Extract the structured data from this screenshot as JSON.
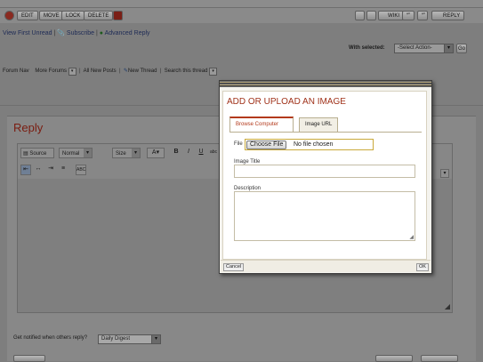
{
  "actionbar": {
    "edit_label": "EDIT",
    "move_label": "MOVE",
    "lock_label": "LOCK",
    "delete_label": "DELETE",
    "wiki_label": "WIKI",
    "quote_label": "“”",
    "reply_label": "REPLY"
  },
  "links": {
    "view_first_unread": "View First Unread",
    "subscribe": "Subscribe",
    "advanced_reply": "Advanced Reply"
  },
  "moderation": {
    "with_selected_label": "With selected:",
    "select_action": "-Select Action-",
    "go_label": "Go"
  },
  "forumnav": {
    "forum_nav": "Forum Nav",
    "more_forums": "More Forums",
    "all_new_posts": "All New Posts",
    "new_thread": "New Thread",
    "search_thread": "Search this thread"
  },
  "reply": {
    "heading": "Reply",
    "source_label": "Source",
    "format_value": "Normal",
    "size_value": "Size",
    "notify_label": "Get notified when others reply?",
    "notify_value": "Daily Digest"
  },
  "modal": {
    "title": "ADD OR UPLOAD AN IMAGE",
    "tabs": [
      "Browse Computer",
      "Image URL"
    ],
    "file_label": "File",
    "choose_file": "Choose File",
    "no_file": "No file chosen",
    "image_title_label": "Image Title",
    "description_label": "Description",
    "cancel_label": "Cancel",
    "ok_label": "OK"
  },
  "colors": {
    "modal_title": "#a0321a",
    "reply_heading": "#7a1c10",
    "overlay": "#7e7e7e"
  }
}
